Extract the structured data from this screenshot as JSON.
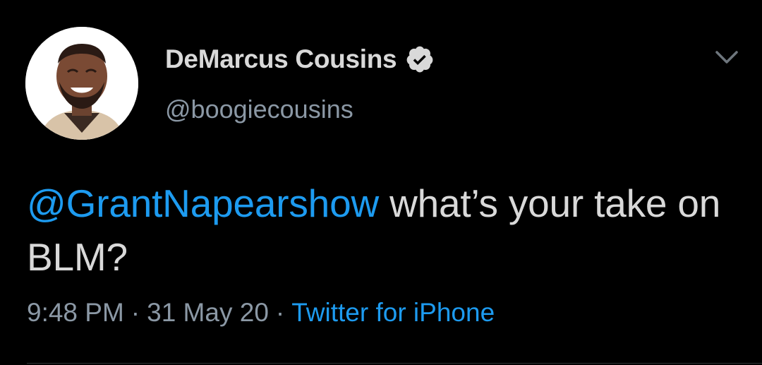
{
  "author": {
    "display_name": "DeMarcus Cousins",
    "handle": "@boogiecousins",
    "verified_icon": "verified-badge-icon"
  },
  "tweet": {
    "mention": "@GrantNapearshow",
    "text": " what’s your take on BLM?"
  },
  "meta": {
    "time": "9:48 PM",
    "separator": "·",
    "date": "31 May 20",
    "source": "Twitter for iPhone"
  },
  "menu_icon": "chevron-down-icon",
  "colors": {
    "background": "#000000",
    "accent": "#1d9bf0",
    "primary_text": "#d9d9d9",
    "secondary_text": "#8b98a5"
  }
}
